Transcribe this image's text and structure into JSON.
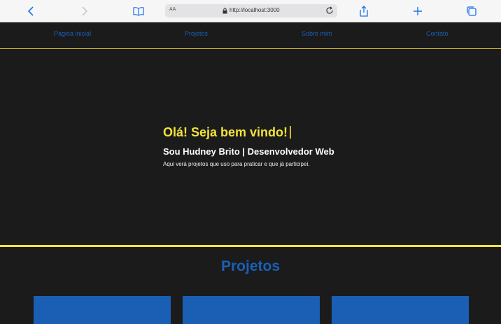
{
  "browser": {
    "address_left": "AA",
    "url": "http://localhost:3000",
    "icons": [
      "back-icon",
      "forward-icon",
      "bookmarks-icon",
      "lock-icon",
      "reload-icon",
      "share-icon",
      "new-tab-icon",
      "tabs-icon"
    ]
  },
  "nav": {
    "items": [
      {
        "label": "Página inicial"
      },
      {
        "label": "Projetos"
      },
      {
        "label": "Sobre mim"
      },
      {
        "label": "Contato"
      }
    ]
  },
  "hero": {
    "greeting": "Olá! Seja bem vindo!",
    "subtitle": "Sou Hudney Brito | Desenvolvedor Web",
    "description": "Aqui verá projetos que uso para praticar e que já participei."
  },
  "projects": {
    "title": "Projetos",
    "cards": 3
  },
  "colors": {
    "background": "#1b1b1c",
    "accent_yellow": "#f1e33a",
    "link_blue": "#1a5fb4",
    "nav_border": "#d4b62b"
  }
}
